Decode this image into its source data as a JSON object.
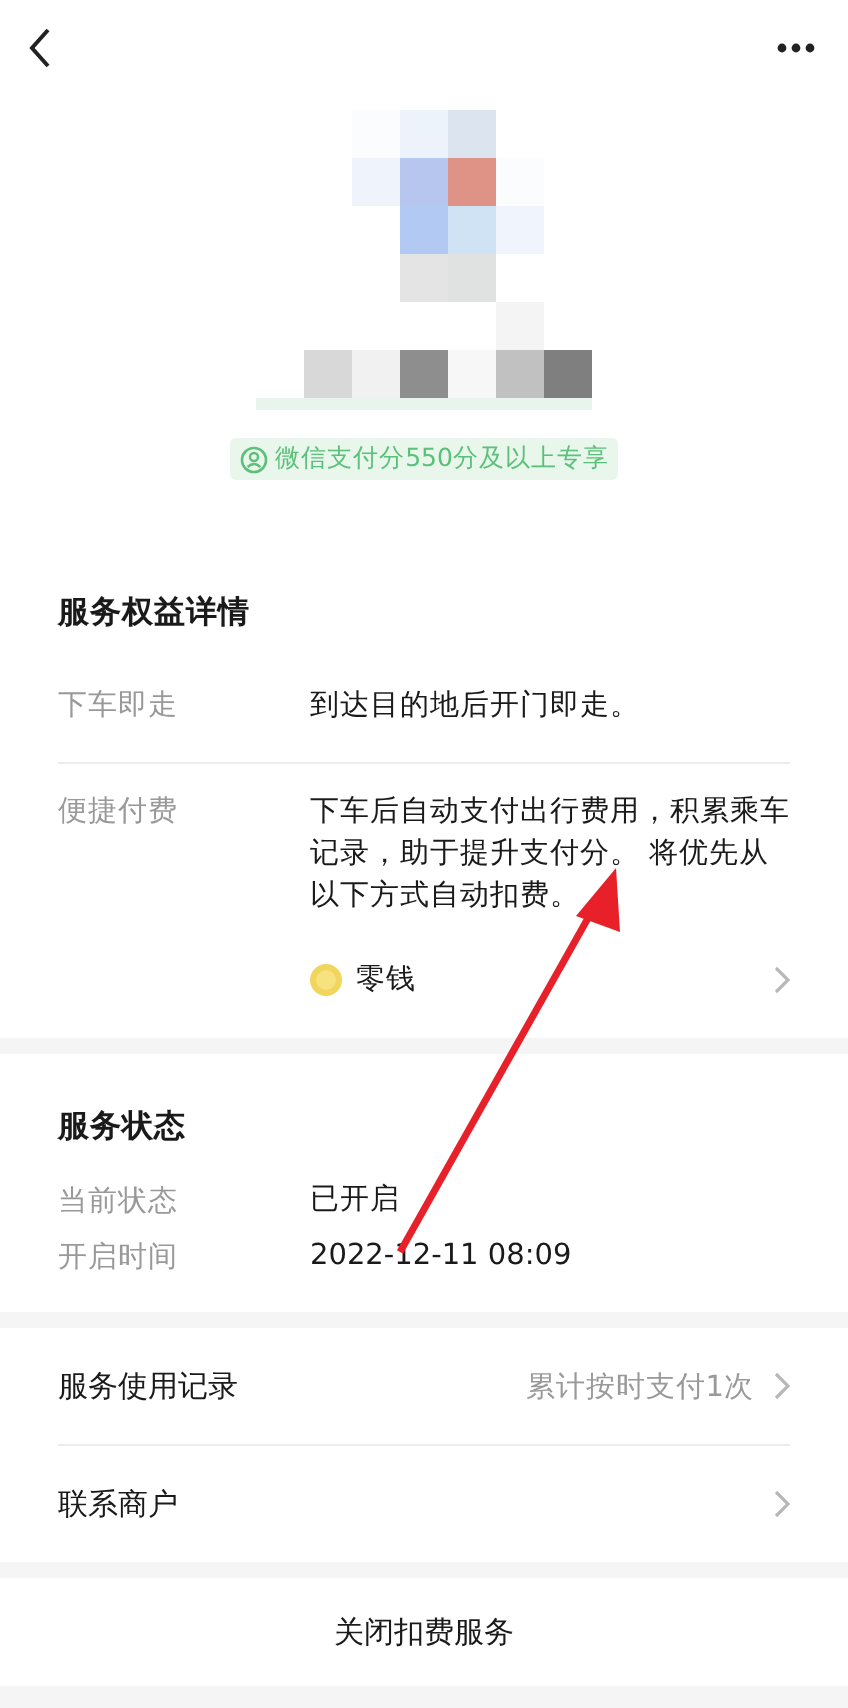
{
  "badge": {
    "text": "微信支付分550分及以上专享"
  },
  "benefits": {
    "title": "服务权益详情",
    "rows": [
      {
        "label": "下车即走",
        "value": "到达目的地后开门即走。"
      },
      {
        "label": "便捷付费",
        "value": "下车后自动支付出行费用，积累乘车记录，助于提升支付分。 将优先从以下方式自动扣费。"
      }
    ],
    "payment_method": {
      "name": "零钱"
    }
  },
  "status": {
    "title": "服务状态",
    "rows": [
      {
        "label": "当前状态",
        "value": "已开启"
      },
      {
        "label": "开启时间",
        "value": "2022-12-11 08:09"
      }
    ]
  },
  "links": [
    {
      "label": "服务使用记录",
      "value": "累计按时支付1次"
    },
    {
      "label": "联系商户"
    }
  ],
  "close_button": "关闭扣费服务"
}
